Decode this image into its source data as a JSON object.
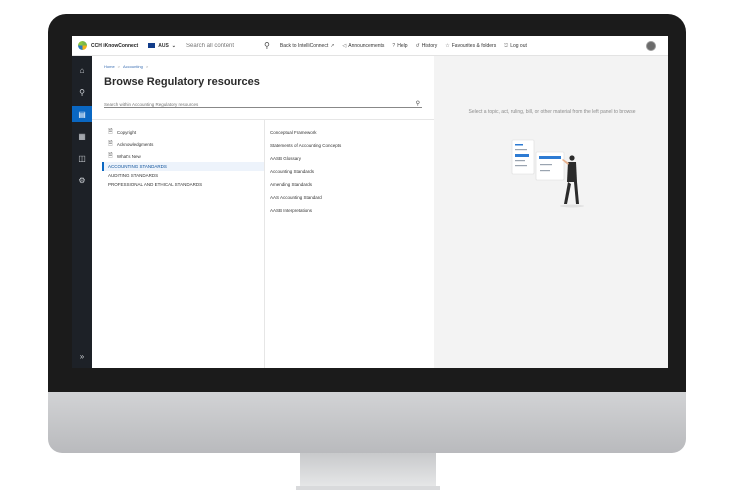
{
  "topbar": {
    "brand": "CCH iKnowConnect",
    "region": "AUS",
    "search_placeholder": "Search all content",
    "links": [
      {
        "label": "Back to IntelliConnect",
        "icon": "external-link-icon"
      },
      {
        "label": "Announcements",
        "icon": "megaphone-icon"
      },
      {
        "label": "Help",
        "icon": "help-icon"
      },
      {
        "label": "History",
        "icon": "history-icon"
      },
      {
        "label": "Favourites & folders",
        "icon": "star-icon"
      },
      {
        "label": "Log out",
        "icon": "logout-icon"
      }
    ]
  },
  "rail": {
    "items": [
      "home-icon",
      "search-icon",
      "library-icon",
      "book-icon",
      "map-icon",
      "tools-icon"
    ],
    "active_index": 2,
    "expand_icon": "expand-icon"
  },
  "content": {
    "breadcrumb": [
      "Home",
      "Accounting"
    ],
    "title": "Browse Regulatory resources",
    "search_placeholder": "Search within Accounting Regulatory resources",
    "column1": {
      "doc_items": [
        "Copyright",
        "Acknowledgments",
        "What's New"
      ],
      "categories": [
        "ACCOUNTING STANDARDS",
        "AUDITING STANDARDS",
        "PROFESSIONAL AND ETHICAL STANDARDS"
      ],
      "selected": "ACCOUNTING STANDARDS"
    },
    "column2": {
      "items": [
        "Conceptual Framework",
        "Statements of Accounting Concepts",
        "AASB Glossary",
        "Accounting Standards",
        "Amending Standards",
        "AAS Accounting Standard",
        "AASB Interpretations"
      ]
    }
  },
  "preview": {
    "message": "Select a topic, act, ruling, bill, or other material from the left panel to browse"
  },
  "colors": {
    "accent": "#0a67c2",
    "rail_bg": "#1d2127",
    "preview_bg": "#f3f3f3",
    "bezel": "#1b1b1b"
  }
}
